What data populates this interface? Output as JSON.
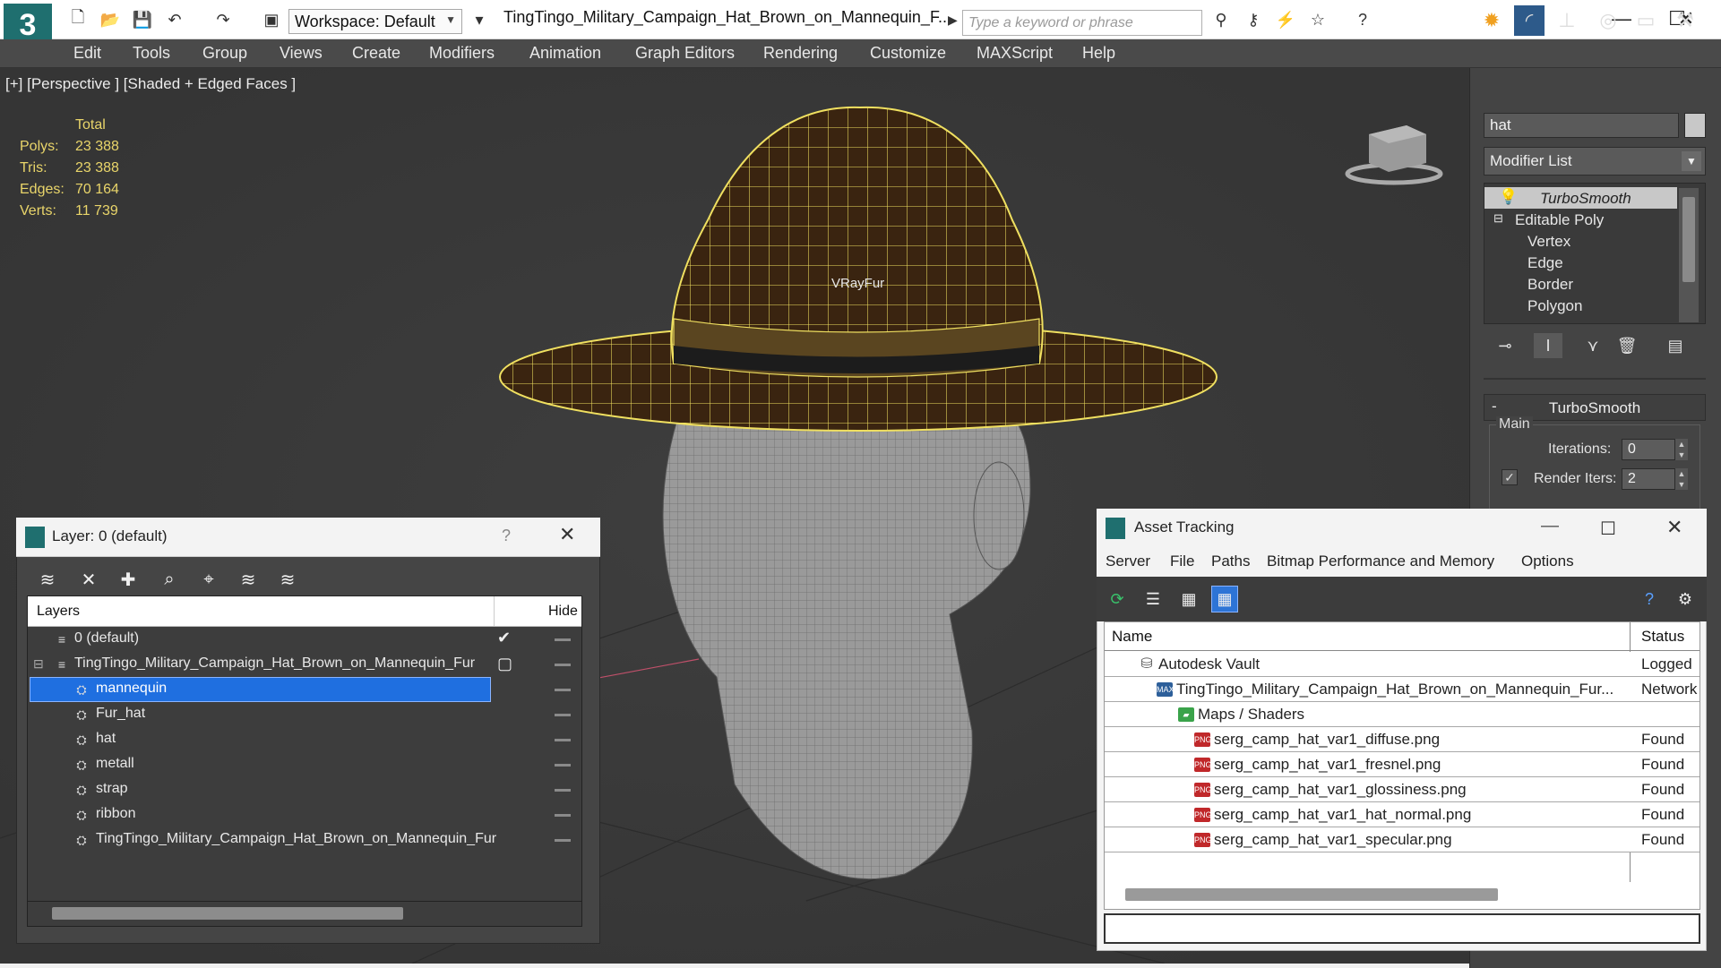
{
  "titlebar": {
    "workspace": "Workspace: Default",
    "title": "TingTingo_Military_Campaign_Hat_Brown_on_Mannequin_F...",
    "search_placeholder": "Type a keyword or phrase"
  },
  "menu": [
    "Edit",
    "Tools",
    "Group",
    "Views",
    "Create",
    "Modifiers",
    "Animation",
    "Graph Editors",
    "Rendering",
    "Customize",
    "MAXScript",
    "Help"
  ],
  "viewport": {
    "label": "[+] [Perspective ] [Shaded + Edged Faces ]",
    "stats": {
      "total_label": "Total",
      "rows": [
        {
          "label": "Polys:",
          "value": "23 388"
        },
        {
          "label": "Tris:",
          "value": "23 388"
        },
        {
          "label": "Edges:",
          "value": "70 164"
        },
        {
          "label": "Verts:",
          "value": "11 739"
        }
      ]
    },
    "object_label": "VRayFur"
  },
  "command_panel": {
    "object_name": "hat",
    "modifier_list": "Modifier List",
    "stack": [
      {
        "label": "TurboSmooth",
        "italic": true,
        "selected": true
      },
      {
        "label": "Editable Poly"
      },
      {
        "label": "Vertex"
      },
      {
        "label": "Edge"
      },
      {
        "label": "Border"
      },
      {
        "label": "Polygon"
      }
    ],
    "rollout_title": "TurboSmooth",
    "rollout_collapse": "-",
    "main_label": "Main",
    "iterations_label": "Iterations:",
    "iterations_value": "0",
    "render_iters_label": "Render Iters:",
    "render_iters_value": "2"
  },
  "layer_window": {
    "title": "Layer: 0 (default)",
    "help": "?",
    "col_layers": "Layers",
    "col_hide": "Hide",
    "rows": [
      {
        "name": "0 (default)",
        "indent": 0,
        "check": "✔"
      },
      {
        "name": "TingTingo_Military_Campaign_Hat_Brown_on_Mannequin_Fur",
        "indent": 0,
        "expand": "⊟",
        "check": "▢"
      },
      {
        "name": "mannequin",
        "indent": 1,
        "selected": true
      },
      {
        "name": "Fur_hat",
        "indent": 1
      },
      {
        "name": "hat",
        "indent": 1
      },
      {
        "name": "metall",
        "indent": 1
      },
      {
        "name": "strap",
        "indent": 1
      },
      {
        "name": "ribbon",
        "indent": 1
      },
      {
        "name": "TingTingo_Military_Campaign_Hat_Brown_on_Mannequin_Fur",
        "indent": 1
      }
    ]
  },
  "asset_window": {
    "title": "Asset Tracking",
    "menu": [
      "Server",
      "File",
      "Paths",
      "Bitmap Performance and Memory",
      "Options"
    ],
    "col_name": "Name",
    "col_status": "Status",
    "rows": [
      {
        "name": "Autodesk Vault",
        "status": "Logged",
        "indent": 1,
        "icon": "vault"
      },
      {
        "name": "TingTingo_Military_Campaign_Hat_Brown_on_Mannequin_Fur...",
        "status": "Network",
        "indent": 2,
        "icon": "max"
      },
      {
        "name": "Maps / Shaders",
        "status": "",
        "indent": 3,
        "icon": "maps"
      },
      {
        "name": "serg_camp_hat_var1_diffuse.png",
        "status": "Found",
        "indent": 4,
        "icon": "png"
      },
      {
        "name": "serg_camp_hat_var1_fresnel.png",
        "status": "Found",
        "indent": 4,
        "icon": "png"
      },
      {
        "name": "serg_camp_hat_var1_glossiness.png",
        "status": "Found",
        "indent": 4,
        "icon": "png"
      },
      {
        "name": "serg_camp_hat_var1_hat_normal.png",
        "status": "Found",
        "indent": 4,
        "icon": "png"
      },
      {
        "name": "serg_camp_hat_var1_specular.png",
        "status": "Found",
        "indent": 4,
        "icon": "png"
      }
    ]
  },
  "colors": {
    "selection": "#1f6fe0",
    "stats": "#e9d56a",
    "wire": "#f0e060",
    "hat": "#3a2410",
    "mesh": "#8e8e8e",
    "png_icon": "#c0282a"
  }
}
